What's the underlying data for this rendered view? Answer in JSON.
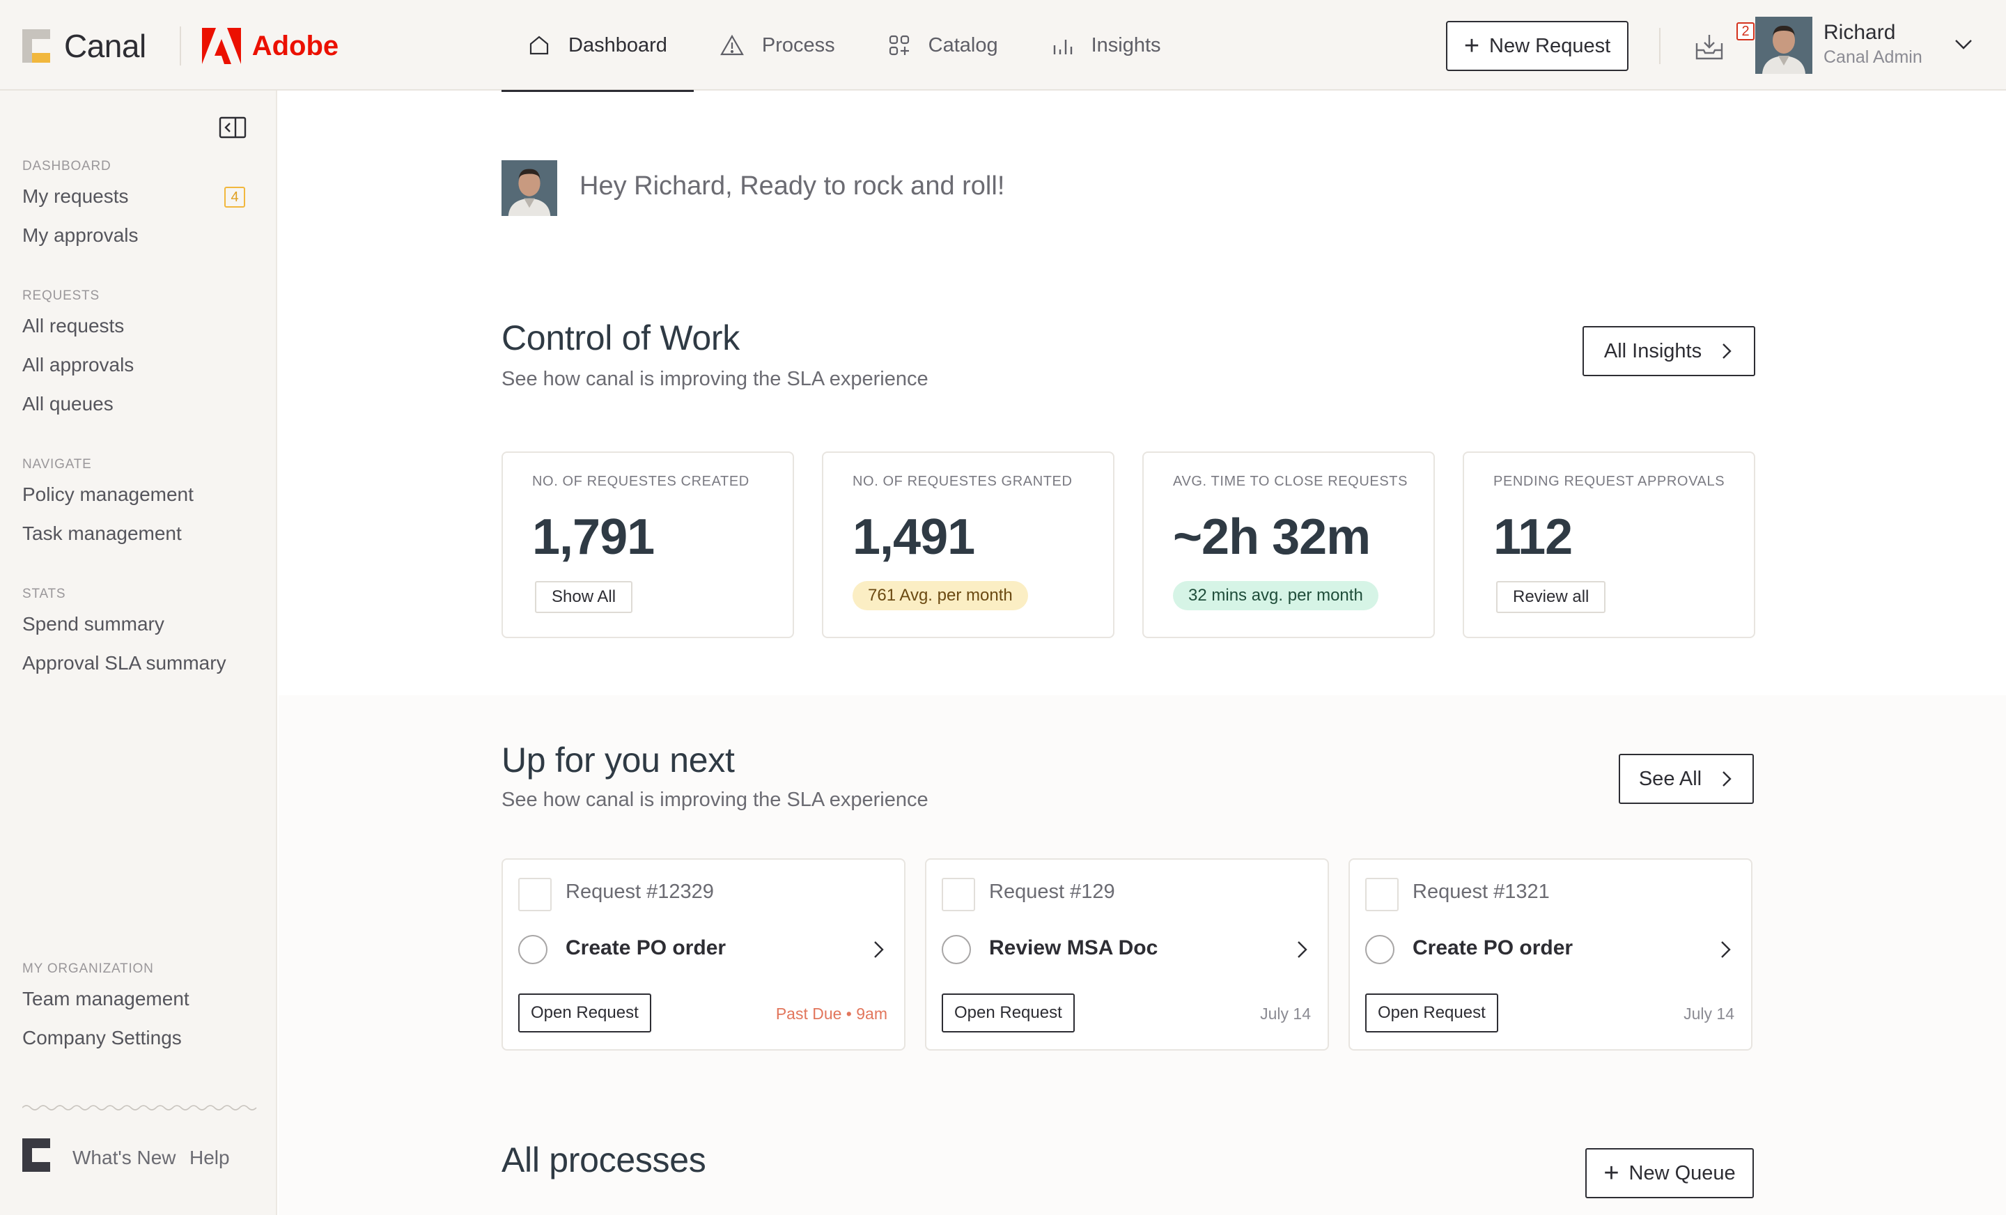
{
  "header": {
    "brand": "Canal",
    "partner": "Adobe",
    "nav": [
      {
        "label": "Dashboard",
        "icon": "home-icon",
        "active": true
      },
      {
        "label": "Process",
        "icon": "warning-triangle-icon",
        "active": false
      },
      {
        "label": "Catalog",
        "icon": "grid-plus-icon",
        "active": false
      },
      {
        "label": "Insights",
        "icon": "bar-chart-icon",
        "active": false
      }
    ],
    "new_request_label": "New Request",
    "inbox_count": "2",
    "user": {
      "name": "Richard",
      "role": "Canal Admin"
    }
  },
  "sidebar": {
    "sections": [
      {
        "title": "DASHBOARD",
        "items": [
          {
            "label": "My requests",
            "badge": "4"
          },
          {
            "label": "My approvals"
          }
        ]
      },
      {
        "title": "REQUESTS",
        "items": [
          {
            "label": "All requests"
          },
          {
            "label": "All approvals"
          },
          {
            "label": "All queues"
          }
        ]
      },
      {
        "title": "NAVIGATE",
        "items": [
          {
            "label": "Policy management"
          },
          {
            "label": "Task management"
          }
        ]
      },
      {
        "title": "STATS",
        "items": [
          {
            "label": "Spend summary"
          },
          {
            "label": "Approval SLA summary"
          }
        ]
      },
      {
        "title": "MY ORGANIZATION",
        "items": [
          {
            "label": "Team management"
          },
          {
            "label": "Company Settings"
          }
        ]
      }
    ],
    "footer": {
      "whats_new": "What's New",
      "help": "Help"
    }
  },
  "greeting": "Hey Richard, Ready to rock and roll!",
  "control_of_work": {
    "title": "Control of Work",
    "subtitle": "See how canal is improving the SLA experience",
    "action_label": "All Insights",
    "stats": [
      {
        "label": "NO. OF REQUESTES CREATED",
        "value": "1,791",
        "action": "Show All"
      },
      {
        "label": "NO. OF REQUESTES GRANTED",
        "value": "1,491",
        "pill": "761 Avg. per month",
        "pill_color": "#fbeec4",
        "pill_text_color": "#6b4a12"
      },
      {
        "label": "AVG. TIME TO CLOSE REQUESTS",
        "value": "~2h 32m",
        "pill": "32 mins avg. per month",
        "pill_color": "#d6f4e6",
        "pill_text_color": "#1f4d3a"
      },
      {
        "label": "PENDING REQUEST APPROVALS",
        "value": "112",
        "action": "Review all"
      }
    ]
  },
  "up_next": {
    "title": "Up for you next",
    "subtitle": "See how canal is improving the SLA experience",
    "action_label": "See All",
    "tasks": [
      {
        "request": "Request #12329",
        "name": "Create PO order",
        "open_label": "Open Request",
        "due": "Past Due • 9am",
        "late": true
      },
      {
        "request": "Request #129",
        "name": "Review MSA Doc",
        "open_label": "Open Request",
        "due": "July 14",
        "late": false
      },
      {
        "request": "Request #1321",
        "name": "Create PO order",
        "open_label": "Open Request",
        "due": "July 14",
        "late": false
      }
    ]
  },
  "all_processes": {
    "title": "All processes",
    "action_label": "New Queue"
  },
  "colors": {
    "accent": "#2d2d33",
    "badge": "#f1b73d",
    "alert": "#d4321d",
    "adobe": "#eb1000"
  }
}
